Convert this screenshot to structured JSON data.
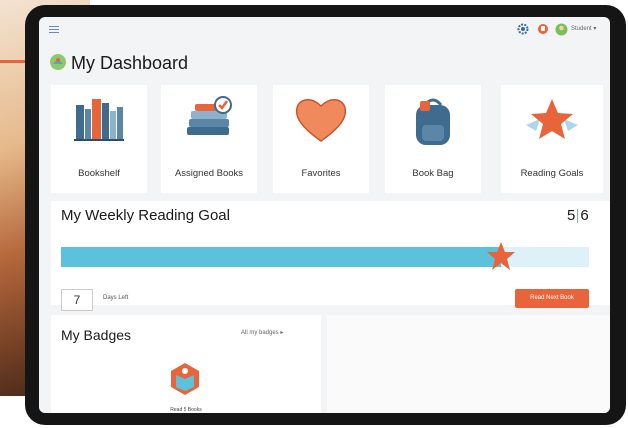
{
  "header": {
    "user_label": "Student ▾"
  },
  "dashboard": {
    "title": "My Dashboard"
  },
  "tiles": [
    {
      "label": "Bookshelf",
      "icon": "bookshelf-icon"
    },
    {
      "label": "Assigned Books",
      "icon": "assigned-books-icon"
    },
    {
      "label": "Favorites",
      "icon": "heart-icon"
    },
    {
      "label": "Book Bag",
      "icon": "backpack-icon"
    },
    {
      "label": "Reading Goals",
      "icon": "star-icon"
    }
  ],
  "goal": {
    "title": "My Weekly Reading Goal",
    "completed": "5",
    "target": "6",
    "progress_fraction": 0.833,
    "days_left_value": "7",
    "days_left_label": "Days Left",
    "button_label": "Read Next Book"
  },
  "badges": {
    "title": "My Badges",
    "link_label": "All my badges ▸",
    "items": [
      {
        "label": "Read 5 Books"
      }
    ]
  },
  "colors": {
    "accent": "#e8643a",
    "progress": "#5cc2dc",
    "progress_track": "#dcf2f8"
  }
}
